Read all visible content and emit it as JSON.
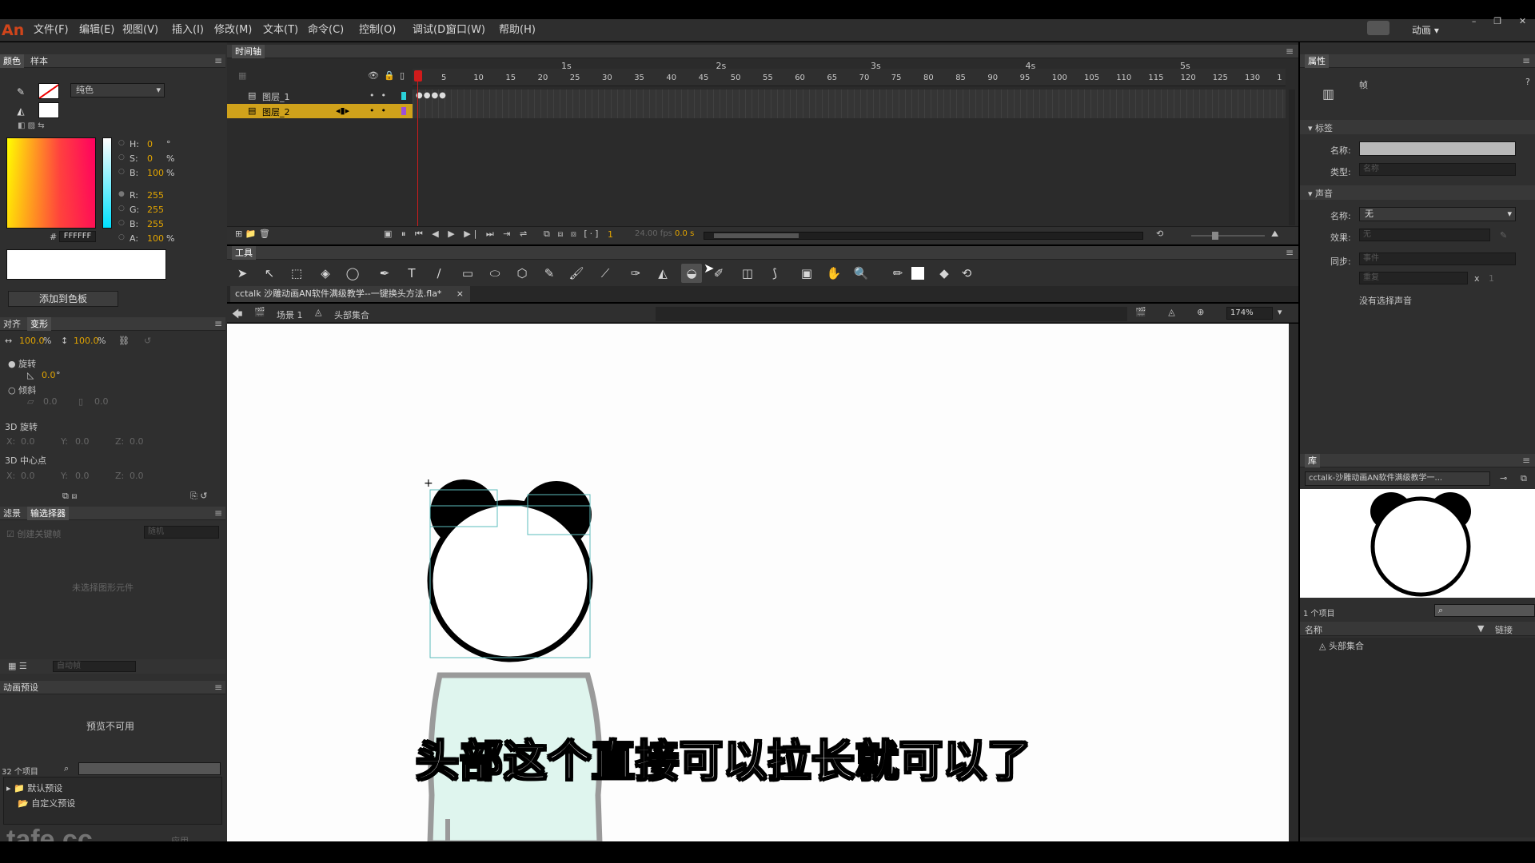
{
  "app": {
    "logo": "An",
    "menus": [
      "文件(F)",
      "编辑(E)",
      "视图(V)",
      "插入(I)",
      "修改(M)",
      "文本(T)",
      "命令(C)",
      "控制(O)",
      "调试(D)",
      "窗口(W)",
      "帮助(H)"
    ],
    "workspace": "动画",
    "window_controls": [
      "–",
      "❐",
      "✕"
    ]
  },
  "color_panel": {
    "tabs": [
      "颜色",
      "样本"
    ],
    "fill_type": "纯色",
    "hsb": [
      {
        "label": "H:",
        "value": "0",
        "unit": "°"
      },
      {
        "label": "S:",
        "value": "0",
        "unit": "%"
      },
      {
        "label": "B:",
        "value": "100",
        "unit": "%"
      }
    ],
    "rgb": [
      {
        "label": "R:",
        "value": "255",
        "unit": ""
      },
      {
        "label": "G:",
        "value": "255",
        "unit": ""
      },
      {
        "label": "B:",
        "value": "255",
        "unit": ""
      },
      {
        "label": "A:",
        "value": "100",
        "unit": "%"
      }
    ],
    "hex_prefix": "#",
    "hex": "FFFFFF",
    "add_swatch": "添加到色板"
  },
  "transform_panel": {
    "tabs": [
      "对齐",
      "变形"
    ],
    "width_pct": "100.0",
    "height_pct": "100.0",
    "pct": "%",
    "rotate_label": "旋转",
    "rotate_value": "0.0",
    "rotate_unit": "°",
    "skew_label": "倾斜",
    "skew_h": "0.0",
    "skew_v": "0.0",
    "rot3d_label": "3D 旋转",
    "center3d_label": "3D 中心点",
    "x": "X:",
    "y": "Y:",
    "z": "Z:",
    "v3d_a": "0.0",
    "v3d_b": "0.0",
    "v3d_c": "0.0",
    "c3d_a": "0.0",
    "c3d_b": "0.0",
    "c3d_c": "0.0"
  },
  "filter_panel": {
    "tabs": [
      "滤景",
      "输选择器"
    ],
    "checkbox_label": "创建关键帧",
    "dropdown": "随机",
    "empty": "未选择图形元件",
    "bottom_dropdown": "自动帧"
  },
  "motion_panel": {
    "title": "动画预设",
    "preview": "预览不可用",
    "count": "32 个项目",
    "folders": [
      "默认预设",
      "自定义预设"
    ],
    "apply": "应用"
  },
  "watermark": "tafe.cc",
  "timeline": {
    "title": "时间轴",
    "layers": [
      {
        "name": "图层_1",
        "color": "#2ad0d8",
        "selected": false
      },
      {
        "name": "图层_2",
        "color": "#9d4fd9",
        "selected": true
      }
    ],
    "frame_numbers": [
      "1",
      "5",
      "10",
      "15",
      "20",
      "25",
      "30",
      "35",
      "40",
      "45",
      "50",
      "55",
      "60",
      "65",
      "70",
      "75",
      "80",
      "85",
      "90",
      "95",
      "100",
      "105",
      "110",
      "115",
      "120",
      "125",
      "130",
      "1"
    ],
    "seconds": [
      "1s",
      "2s",
      "3s",
      "4s",
      "5s"
    ],
    "current_frame": "1",
    "fps": "24.00 fps",
    "time": "0.0 s"
  },
  "tools_panel": {
    "title": "工具",
    "tools": [
      "selection-tool",
      "subselection-tool",
      "free-transform-tool",
      "3d-rotation-tool",
      "lasso-tool",
      "pen-tool",
      "text-tool",
      "line-tool",
      "rectangle-tool",
      "oval-tool",
      "polystar-tool",
      "pencil-tool",
      "brush-tool",
      "paint-brush-tool",
      "bone-tool",
      "paint-bucket-tool",
      "ink-bottle-tool",
      "eyedropper-tool",
      "eraser-tool",
      "width-tool",
      "camera-tool",
      "hand-tool",
      "zoom-tool",
      "stroke-color",
      "fill-color",
      "swap-colors",
      "snap-tool"
    ],
    "glyphs": [
      "➤",
      "↖",
      "⬚",
      "◈",
      "◯",
      "✒",
      "T",
      "∕",
      "▭",
      "⬭",
      "⬡",
      "✎",
      "🖌",
      "⟋",
      "✑",
      "◭",
      "◒",
      "✐",
      "◫",
      "⟆",
      "▣",
      "✋",
      "🔍",
      "✏",
      "◪",
      "◆",
      "⟲"
    ]
  },
  "document": {
    "tab": "cctalk 沙雕动画AN软件满级教学--一键换头方法.fla*",
    "scene": "场景 1",
    "symbol": "头部集合",
    "zoom": "174%"
  },
  "subtitle": "头部这个直接可以拉长就可以了",
  "properties": {
    "title": "属性",
    "type_label": "帧",
    "label_section": "标签",
    "name_label": "名称:",
    "type_field_label": "类型:",
    "type_value": "名称",
    "sound_section": "声音",
    "sound_name_label": "名称:",
    "sound_name": "无",
    "effect_label": "效果:",
    "effect_value": "无",
    "sync_label": "同步:",
    "sync_value": "事件",
    "repeat_value": "重复",
    "repeat_x": "x",
    "repeat_count": "1",
    "no_sound": "没有选择声音"
  },
  "library": {
    "title": "库",
    "doc": "cctalk-沙雕动画AN软件满级教学一...",
    "count": "1 个项目",
    "col_name": "名称",
    "col_link": "链接",
    "items": [
      "头部集合"
    ]
  }
}
